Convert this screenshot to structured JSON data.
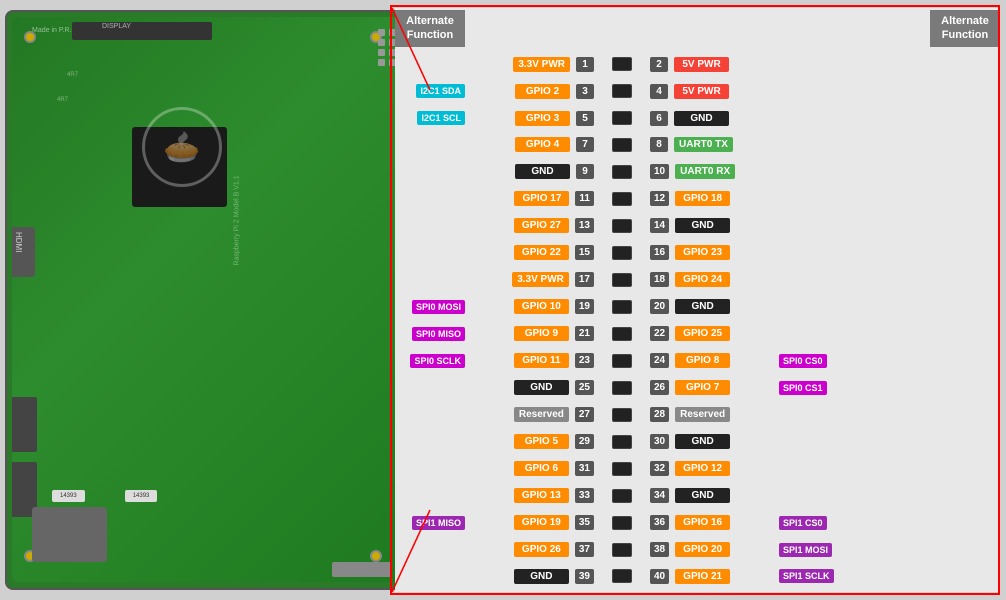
{
  "header": {
    "left_title": "Alternate\nFunction",
    "right_title": "Alternate\nFunction"
  },
  "pins": [
    {
      "left_alt": "",
      "left_label": "3.3V PWR",
      "left_color": "c-orange",
      "left_num": "1",
      "right_num": "2",
      "right_label": "5V PWR",
      "right_color": "c-red",
      "right_alt": ""
    },
    {
      "left_alt": "I2C1 SDA",
      "left_alt_color": "c-cyan",
      "left_label": "GPIO 2",
      "left_color": "c-orange",
      "left_num": "3",
      "right_num": "4",
      "right_label": "5V PWR",
      "right_color": "c-red",
      "right_alt": ""
    },
    {
      "left_alt": "I2C1 SCL",
      "left_alt_color": "c-cyan",
      "left_label": "GPIO 3",
      "left_color": "c-orange",
      "left_num": "5",
      "right_num": "6",
      "right_label": "GND",
      "right_color": "c-black",
      "right_alt": ""
    },
    {
      "left_alt": "",
      "left_label": "GPIO 4",
      "left_color": "c-orange",
      "left_num": "7",
      "right_num": "8",
      "right_label": "UART0 TX",
      "right_color": "c-green",
      "right_alt": ""
    },
    {
      "left_alt": "",
      "left_label": "GND",
      "left_color": "c-black",
      "left_num": "9",
      "right_num": "10",
      "right_label": "UART0 RX",
      "right_color": "c-green",
      "right_alt": ""
    },
    {
      "left_alt": "",
      "left_label": "GPIO 17",
      "left_color": "c-orange",
      "left_num": "11",
      "right_num": "12",
      "right_label": "GPIO 18",
      "right_color": "c-orange",
      "right_alt": ""
    },
    {
      "left_alt": "",
      "left_label": "GPIO 27",
      "left_color": "c-orange",
      "left_num": "13",
      "right_num": "14",
      "right_label": "GND",
      "right_color": "c-black",
      "right_alt": ""
    },
    {
      "left_alt": "",
      "left_label": "GPIO 22",
      "left_color": "c-orange",
      "left_num": "15",
      "right_num": "16",
      "right_label": "GPIO 23",
      "right_color": "c-orange",
      "right_alt": ""
    },
    {
      "left_alt": "",
      "left_label": "3.3V PWR",
      "left_color": "c-orange",
      "left_num": "17",
      "right_num": "18",
      "right_label": "GPIO 24",
      "right_color": "c-orange",
      "right_alt": ""
    },
    {
      "left_alt": "SPI0 MOSI",
      "left_alt_color": "c-magenta",
      "left_label": "GPIO 10",
      "left_color": "c-orange",
      "left_num": "19",
      "right_num": "20",
      "right_label": "GND",
      "right_color": "c-black",
      "right_alt": ""
    },
    {
      "left_alt": "SPI0 MISO",
      "left_alt_color": "c-magenta",
      "left_label": "GPIO 9",
      "left_color": "c-orange",
      "left_num": "21",
      "right_num": "22",
      "right_label": "GPIO 25",
      "right_color": "c-orange",
      "right_alt": ""
    },
    {
      "left_alt": "SPI0 SCLK",
      "left_alt_color": "c-magenta",
      "left_label": "GPIO 11",
      "left_color": "c-orange",
      "left_num": "23",
      "right_num": "24",
      "right_label": "GPIO 8",
      "right_color": "c-orange",
      "right_alt": "SPI0 CS0",
      "right_alt_color": "c-magenta"
    },
    {
      "left_alt": "",
      "left_label": "GND",
      "left_color": "c-black",
      "left_num": "25",
      "right_num": "26",
      "right_label": "GPIO 7",
      "right_color": "c-orange",
      "right_alt": "SPI0 CS1",
      "right_alt_color": "c-magenta"
    },
    {
      "left_alt": "",
      "left_label": "Reserved",
      "left_color": "c-gray",
      "left_num": "27",
      "right_num": "28",
      "right_label": "Reserved",
      "right_color": "c-gray",
      "right_alt": ""
    },
    {
      "left_alt": "",
      "left_label": "GPIO 5",
      "left_color": "c-orange",
      "left_num": "29",
      "right_num": "30",
      "right_label": "GND",
      "right_color": "c-black",
      "right_alt": ""
    },
    {
      "left_alt": "",
      "left_label": "GPIO 6",
      "left_color": "c-orange",
      "left_num": "31",
      "right_num": "32",
      "right_label": "GPIO 12",
      "right_color": "c-orange",
      "right_alt": ""
    },
    {
      "left_alt": "",
      "left_label": "GPIO 13",
      "left_color": "c-orange",
      "left_num": "33",
      "right_num": "34",
      "right_label": "GND",
      "right_color": "c-black",
      "right_alt": ""
    },
    {
      "left_alt": "SPI1 MISO",
      "left_alt_color": "c-purple",
      "left_label": "GPIO 19",
      "left_color": "c-orange",
      "left_num": "35",
      "right_num": "36",
      "right_label": "GPIO 16",
      "right_color": "c-orange",
      "right_alt": "SPI1 CS0",
      "right_alt_color": "c-purple"
    },
    {
      "left_alt": "",
      "left_label": "GPIO 26",
      "left_color": "c-orange",
      "left_num": "37",
      "right_num": "38",
      "right_label": "GPIO 20",
      "right_color": "c-orange",
      "right_alt": "SPI1 MOSI",
      "right_alt_color": "c-purple"
    },
    {
      "left_alt": "",
      "left_label": "GND",
      "left_color": "c-black",
      "left_num": "39",
      "right_num": "40",
      "right_label": "GPIO 21",
      "right_color": "c-orange",
      "right_alt": "SPI1 SCLK",
      "right_alt_color": "c-purple"
    }
  ]
}
